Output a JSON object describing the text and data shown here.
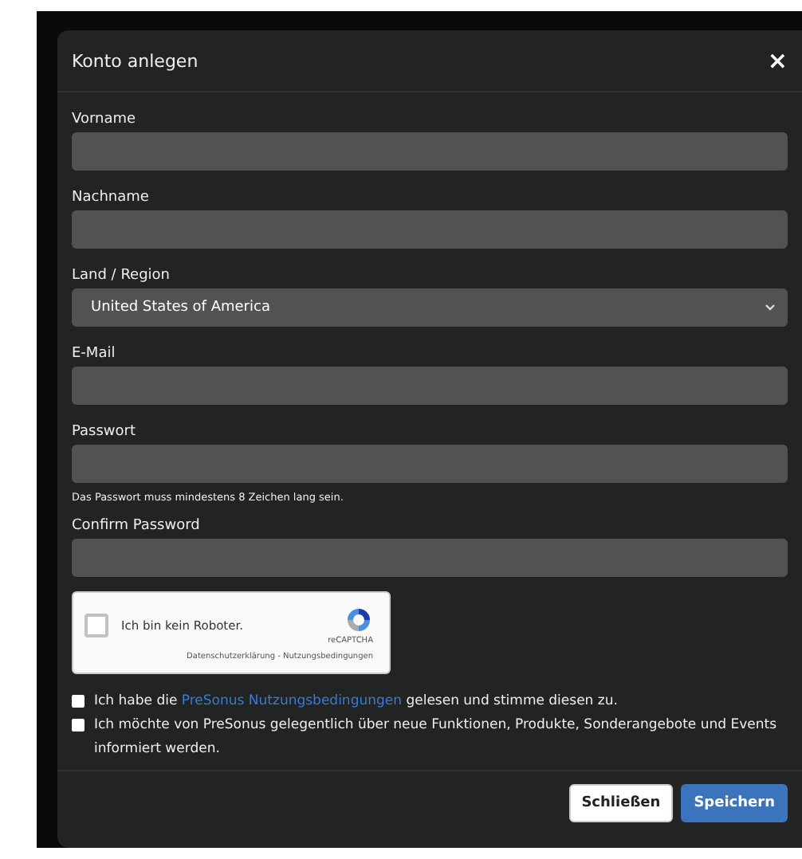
{
  "dialog": {
    "title": "Konto anlegen",
    "close": "×"
  },
  "fields": [
    {
      "kind": "text",
      "label": "Vorname"
    },
    {
      "kind": "text",
      "label": "Nachname"
    },
    {
      "kind": "select",
      "label": "Land / Region",
      "value": "United States of America"
    },
    {
      "kind": "text",
      "label": "E-Mail"
    },
    {
      "kind": "password",
      "label": "Passwort",
      "hint": "Das Passwort muss mindestens 8 Zeichen lang sein."
    },
    {
      "kind": "password",
      "label": "Confirm Password"
    }
  ],
  "captcha": {
    "label": "Ich bin kein Roboter.",
    "brand": "reCAPTCHA",
    "links": "Datenschutzerklärung - Nutzungsbedingungen",
    "checked": false
  },
  "consents": [
    {
      "checked": false,
      "before": "Ich habe die ",
      "link": "PreSonus Nutzungsbedingungen",
      "after": " gelesen und stimme diesen zu."
    },
    {
      "checked": false,
      "before": "Ich möchte von PreSonus gelegentlich über neue Funktionen, Produkte, Sonderangebote und Events informiert werden."
    }
  ],
  "buttons": [
    {
      "label": "Schließen",
      "kind": "secondary"
    },
    {
      "label": "Speichern",
      "kind": "primary"
    }
  ]
}
